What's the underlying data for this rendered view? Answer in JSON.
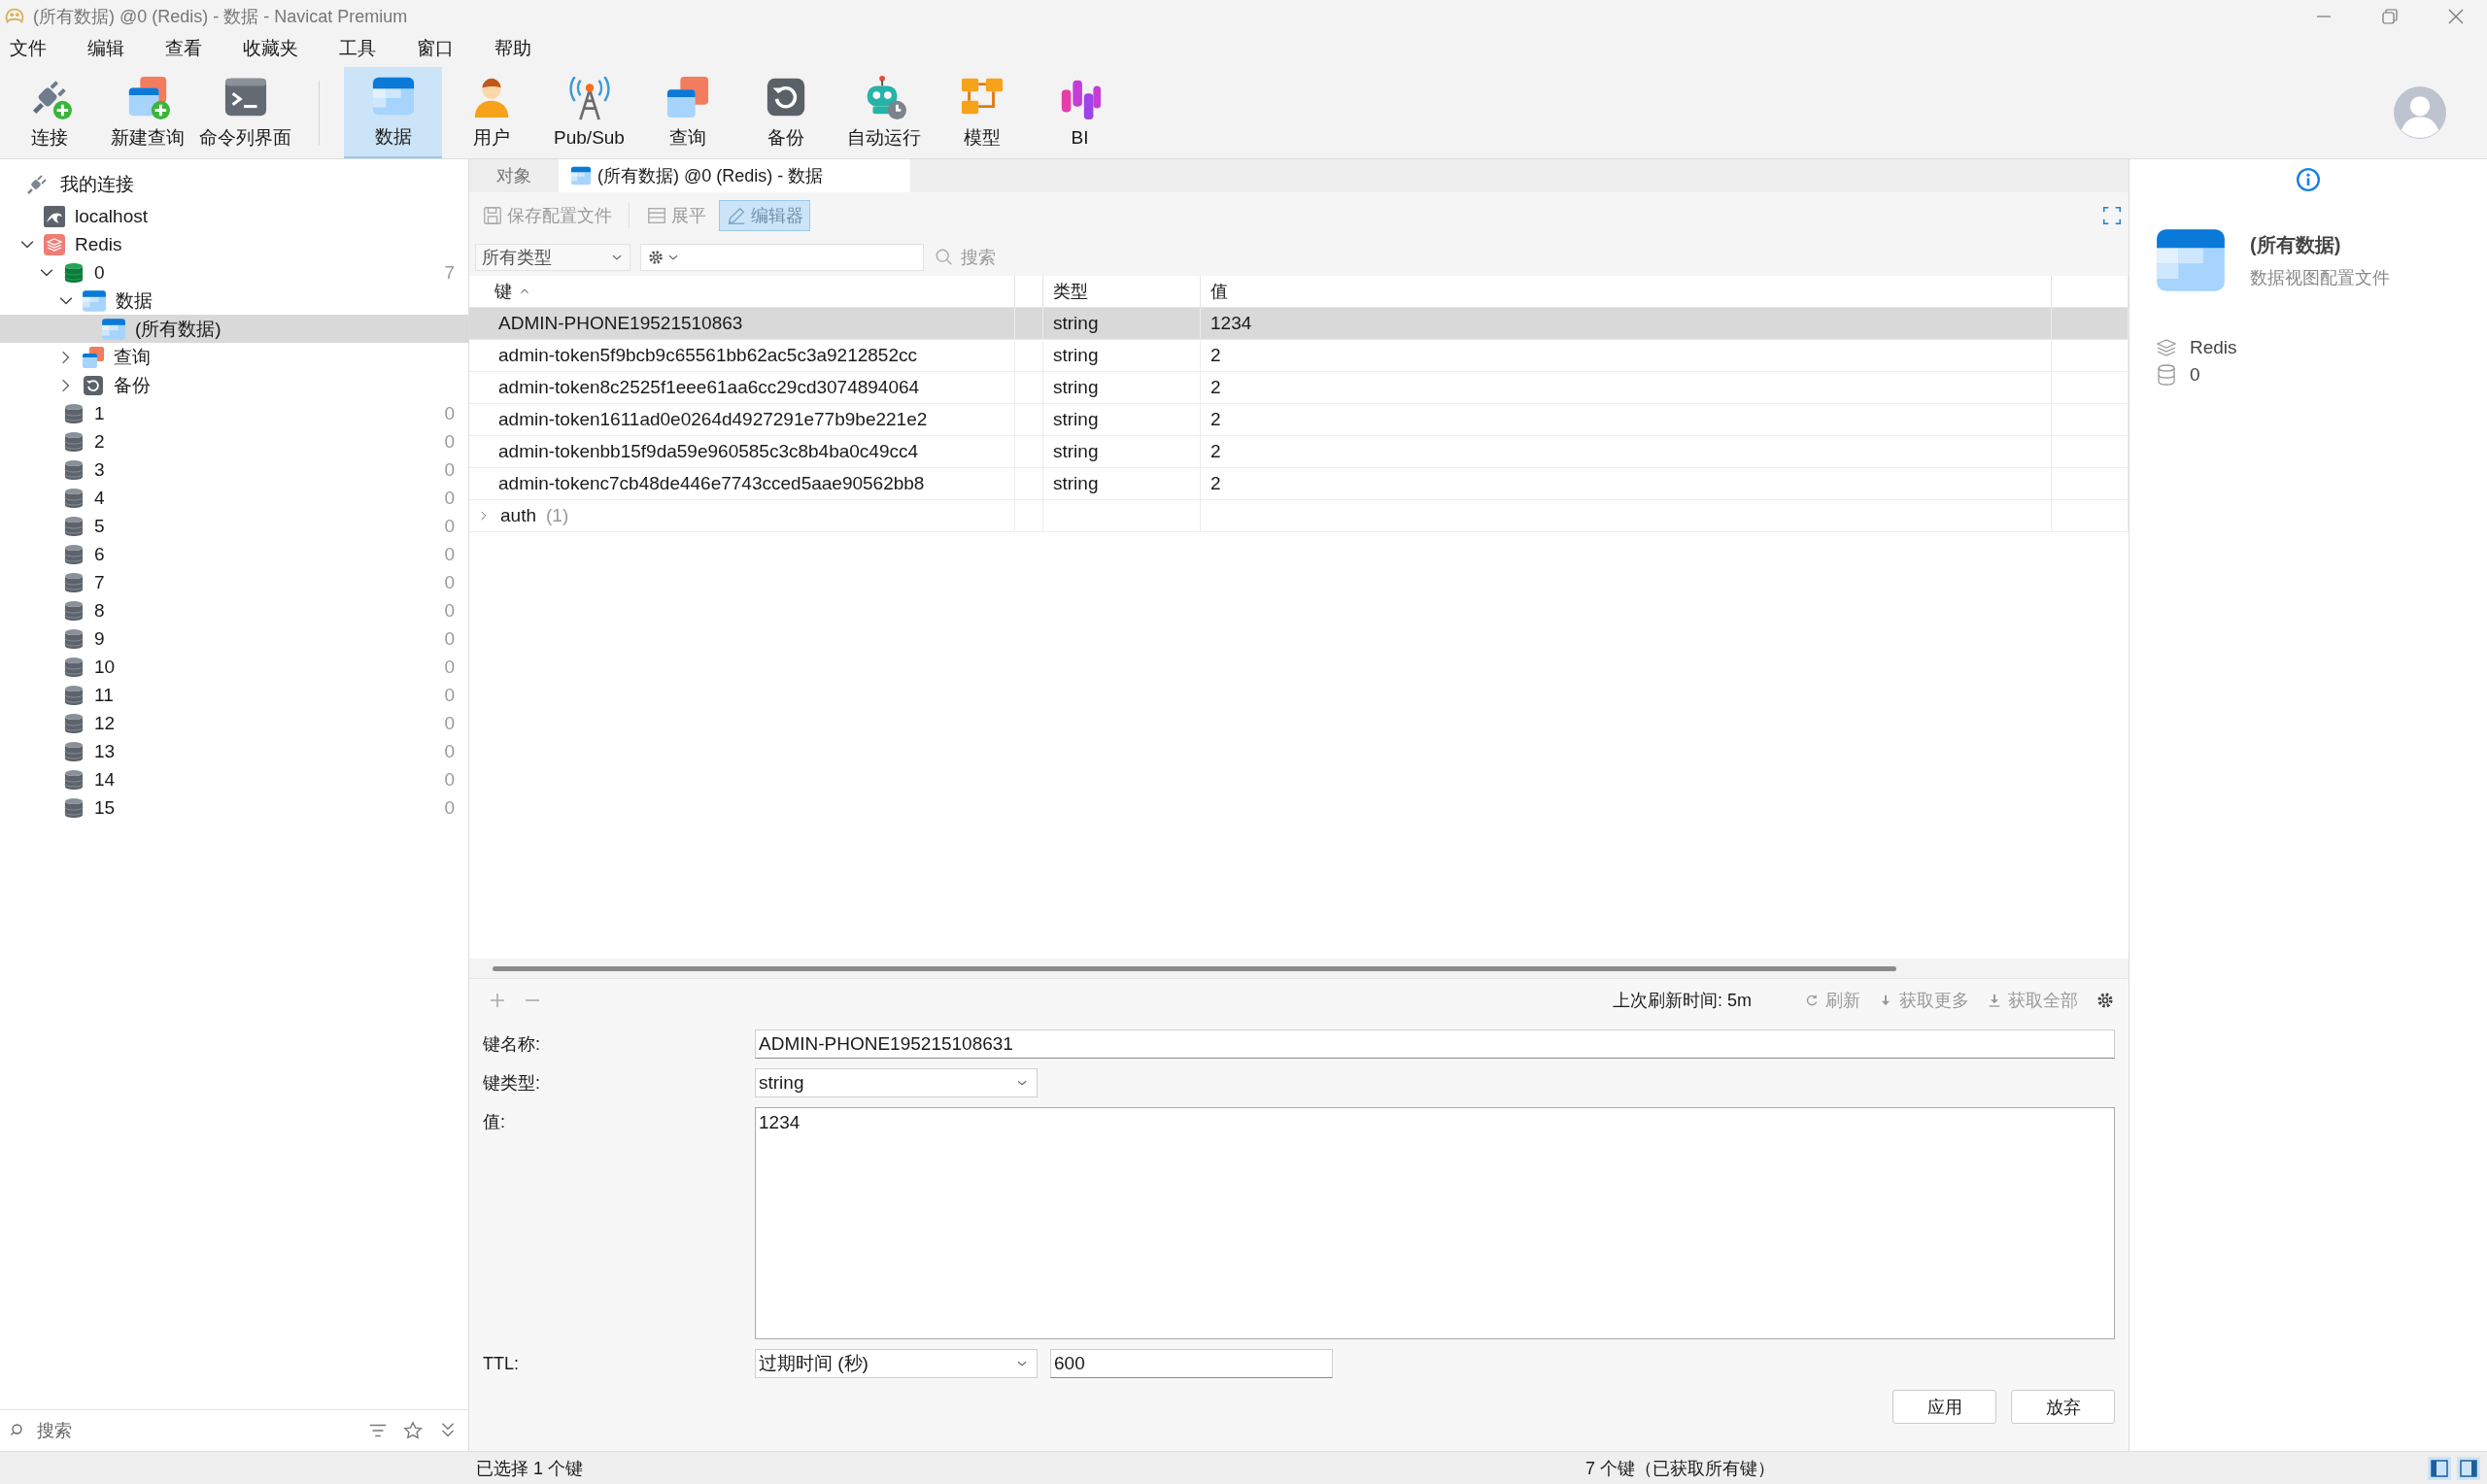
{
  "window": {
    "title": "(所有数据) @0 (Redis) - 数据 - Navicat Premium"
  },
  "menu": [
    "文件",
    "编辑",
    "查看",
    "收藏夹",
    "工具",
    "窗口",
    "帮助"
  ],
  "toolbar": [
    {
      "label": "连接",
      "kind": "connect",
      "selected": false
    },
    {
      "label": "新建查询",
      "kind": "new-query",
      "selected": false
    },
    {
      "label": "命令列界面",
      "kind": "console",
      "selected": false
    },
    {
      "label": "数据",
      "kind": "data",
      "selected": true
    },
    {
      "label": "用户",
      "kind": "user",
      "selected": false
    },
    {
      "label": "Pub/Sub",
      "kind": "pubsub",
      "selected": false
    },
    {
      "label": "查询",
      "kind": "query",
      "selected": false
    },
    {
      "label": "备份",
      "kind": "backup",
      "selected": false
    },
    {
      "label": "自动运行",
      "kind": "automation",
      "selected": false
    },
    {
      "label": "模型",
      "kind": "model",
      "selected": false
    },
    {
      "label": "BI",
      "kind": "bi",
      "selected": false
    }
  ],
  "sidebar": {
    "header": "我的连接",
    "tree": [
      {
        "label": "localhost",
        "kind": "mysql",
        "selected": false
      },
      {
        "label": "Redis",
        "kind": "redis",
        "selected": false,
        "expanded": true,
        "children": [
          {
            "label": "0",
            "kind": "db",
            "active": true,
            "count": "7",
            "selected": false,
            "expanded": true,
            "children": [
              {
                "label": "数据",
                "kind": "data",
                "selected": false,
                "expanded": true,
                "children": [
                  {
                    "label": "(所有数据)",
                    "kind": "data",
                    "selected": true
                  }
                ]
              },
              {
                "label": "查询",
                "kind": "query",
                "selected": false,
                "expanded": false
              },
              {
                "label": "备份",
                "kind": "backup",
                "selected": false,
                "expanded": false
              }
            ]
          },
          {
            "label": "1",
            "kind": "db",
            "active": false,
            "count": "0",
            "selected": false
          },
          {
            "label": "2",
            "kind": "db",
            "active": false,
            "count": "0",
            "selected": false
          },
          {
            "label": "3",
            "kind": "db",
            "active": false,
            "count": "0",
            "selected": false
          },
          {
            "label": "4",
            "kind": "db",
            "active": false,
            "count": "0",
            "selected": false
          },
          {
            "label": "5",
            "kind": "db",
            "active": false,
            "count": "0",
            "selected": false
          },
          {
            "label": "6",
            "kind": "db",
            "active": false,
            "count": "0",
            "selected": false
          },
          {
            "label": "7",
            "kind": "db",
            "active": false,
            "count": "0",
            "selected": false
          },
          {
            "label": "8",
            "kind": "db",
            "active": false,
            "count": "0",
            "selected": false
          },
          {
            "label": "9",
            "kind": "db",
            "active": false,
            "count": "0",
            "selected": false
          },
          {
            "label": "10",
            "kind": "db",
            "active": false,
            "count": "0",
            "selected": false
          },
          {
            "label": "11",
            "kind": "db",
            "active": false,
            "count": "0",
            "selected": false
          },
          {
            "label": "12",
            "kind": "db",
            "active": false,
            "count": "0",
            "selected": false
          },
          {
            "label": "13",
            "kind": "db",
            "active": false,
            "count": "0",
            "selected": false
          },
          {
            "label": "14",
            "kind": "db",
            "active": false,
            "count": "0",
            "selected": false
          },
          {
            "label": "15",
            "kind": "db",
            "active": false,
            "count": "0",
            "selected": false
          }
        ]
      }
    ],
    "search": {
      "placeholder": "搜索"
    }
  },
  "tabs": [
    {
      "label": "对象",
      "selected": false
    },
    {
      "label": "(所有数据) @0 (Redis) - 数据",
      "selected": true
    }
  ],
  "actions": [
    {
      "label": "保存配置文件",
      "kind": "save",
      "disabled": true,
      "selected": false
    },
    {
      "label": "展平",
      "kind": "flat",
      "disabled": true,
      "selected": false
    },
    {
      "label": "编辑器",
      "kind": "edit",
      "disabled": false,
      "selected": true
    }
  ],
  "filter": {
    "type": "所有类型",
    "search_placeholder": "搜索"
  },
  "table": {
    "columns": [
      {
        "label": "键",
        "sorted": true
      },
      {
        "label": "类型",
        "sorted": false
      },
      {
        "label": "值",
        "sorted": false
      }
    ],
    "rows": [
      {
        "kind": "key",
        "key": "ADMIN-PHONE19521510863",
        "type": "string",
        "value": "1234",
        "selected": true
      },
      {
        "kind": "key",
        "key": "admin-token5f9bcb9c65561bb62ac5c3a9212852cc",
        "type": "string",
        "value": "2",
        "selected": false
      },
      {
        "kind": "key",
        "key": "admin-token8c2525f1eee61aa6cc29cd3074894064",
        "type": "string",
        "value": "2",
        "selected": false
      },
      {
        "kind": "key",
        "key": "admin-token1611ad0e0264d4927291e77b9be221e2",
        "type": "string",
        "value": "2",
        "selected": false
      },
      {
        "kind": "key",
        "key": "admin-tokenbb15f9da59e960585c3c8b4ba0c49cc4",
        "type": "string",
        "value": "2",
        "selected": false
      },
      {
        "kind": "key",
        "key": "admin-tokenc7cb48de446e7743cced5aae90562bb8",
        "type": "string",
        "value": "2",
        "selected": false
      },
      {
        "kind": "group",
        "key": "auth",
        "count": "(1)",
        "expanded": false,
        "selected": false
      }
    ]
  },
  "editor_toolbar": {
    "refresh_time": "上次刷新时间: 5m",
    "actions": [
      {
        "label": "刷新",
        "kind": "refresh",
        "disabled": true
      },
      {
        "label": "获取更多",
        "kind": "more",
        "disabled": true
      },
      {
        "label": "获取全部",
        "kind": "all",
        "disabled": true
      }
    ]
  },
  "form": {
    "key_name": {
      "label": "键名称:",
      "value": "ADMIN-PHONE195215108631"
    },
    "key_type": {
      "label": "键类型:",
      "value": "string"
    },
    "value": {
      "label": "值:",
      "value": "1234"
    },
    "ttl": {
      "label": "TTL:",
      "mode": "过期时间 (秒)",
      "value": "600"
    }
  },
  "buttons": [
    "应用",
    "放弃"
  ],
  "info_panel": {
    "title": "(所有数据)",
    "subtitle": "数据视图配置文件",
    "details": [
      {
        "kind": "server",
        "text": "Redis"
      },
      {
        "kind": "db",
        "text": "0"
      }
    ]
  },
  "status_bar": {
    "left": "已选择 1 个键",
    "right": "7 个键（已获取所有键）"
  }
}
